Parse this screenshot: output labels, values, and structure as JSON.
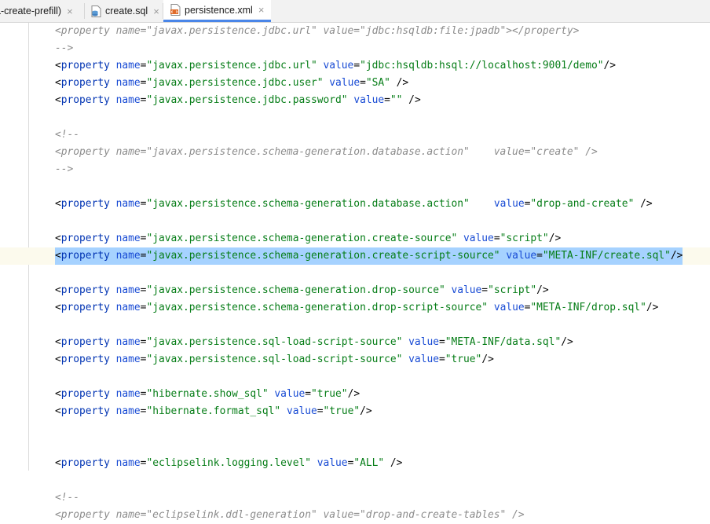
{
  "tabs": [
    {
      "label": "a-create-prefill)",
      "icon": "none",
      "active": false
    },
    {
      "label": "create.sql",
      "icon": "sql-file-icon",
      "active": false
    },
    {
      "label": "persistence.xml",
      "icon": "xml-file-icon",
      "active": true
    }
  ],
  "close_glyph": "×",
  "highlight_color": "#a6d2ff",
  "lines": [
    {
      "kind": "comment",
      "text": "<property name=\"javax.persistence.jdbc.url\" value=\"jdbc:hsqldb:file:jpadb\"></property>"
    },
    {
      "kind": "comment",
      "text": "-->"
    },
    {
      "kind": "prop",
      "name": "javax.persistence.jdbc.url",
      "gap": " ",
      "value": "jdbc:hsqldb:hsql://localhost:9001/demo",
      "end": "/>"
    },
    {
      "kind": "prop",
      "name": "javax.persistence.jdbc.user",
      "gap": " ",
      "value": "SA",
      "end": " />"
    },
    {
      "kind": "prop",
      "name": "javax.persistence.jdbc.password",
      "gap": " ",
      "value": "",
      "end": " />"
    },
    {
      "kind": "blank"
    },
    {
      "kind": "comment",
      "text": "<!--"
    },
    {
      "kind": "comment",
      "text": "<property name=\"javax.persistence.schema-generation.database.action\"    value=\"create\" />"
    },
    {
      "kind": "comment",
      "text": "-->"
    },
    {
      "kind": "blank"
    },
    {
      "kind": "prop",
      "name": "javax.persistence.schema-generation.database.action",
      "gap": "    ",
      "value": "drop-and-create",
      "end": " />"
    },
    {
      "kind": "blank"
    },
    {
      "kind": "prop",
      "name": "javax.persistence.schema-generation.create-source",
      "gap": " ",
      "value": "script",
      "end": "/>"
    },
    {
      "kind": "prop",
      "name": "javax.persistence.schema-generation.create-script-source",
      "gap": " ",
      "value": "META-INF/create.sql",
      "end": "/>",
      "selected": true
    },
    {
      "kind": "blank"
    },
    {
      "kind": "prop",
      "name": "javax.persistence.schema-generation.drop-source",
      "gap": " ",
      "value": "script",
      "end": "/>"
    },
    {
      "kind": "prop",
      "name": "javax.persistence.schema-generation.drop-script-source",
      "gap": " ",
      "value": "META-INF/drop.sql",
      "end": "/>"
    },
    {
      "kind": "blank"
    },
    {
      "kind": "prop",
      "name": "javax.persistence.sql-load-script-source",
      "gap": " ",
      "value": "META-INF/data.sql",
      "end": "/>"
    },
    {
      "kind": "prop",
      "name": "javax.persistence.sql-load-script-source",
      "gap": " ",
      "value": "true",
      "end": "/>"
    },
    {
      "kind": "blank"
    },
    {
      "kind": "prop",
      "name": "hibernate.show_sql",
      "gap": " ",
      "value": "true",
      "end": "/>"
    },
    {
      "kind": "prop",
      "name": "hibernate.format_sql",
      "gap": " ",
      "value": "true",
      "end": "/>"
    },
    {
      "kind": "blank"
    },
    {
      "kind": "blank"
    },
    {
      "kind": "prop",
      "name": "eclipselink.logging.level",
      "gap": " ",
      "value": "ALL",
      "end": " />"
    },
    {
      "kind": "blank"
    },
    {
      "kind": "comment",
      "text": "<!--"
    },
    {
      "kind": "comment",
      "text": "<property name=\"eclipselink.ddl-generation\" value=\"drop-and-create-tables\" />"
    }
  ]
}
